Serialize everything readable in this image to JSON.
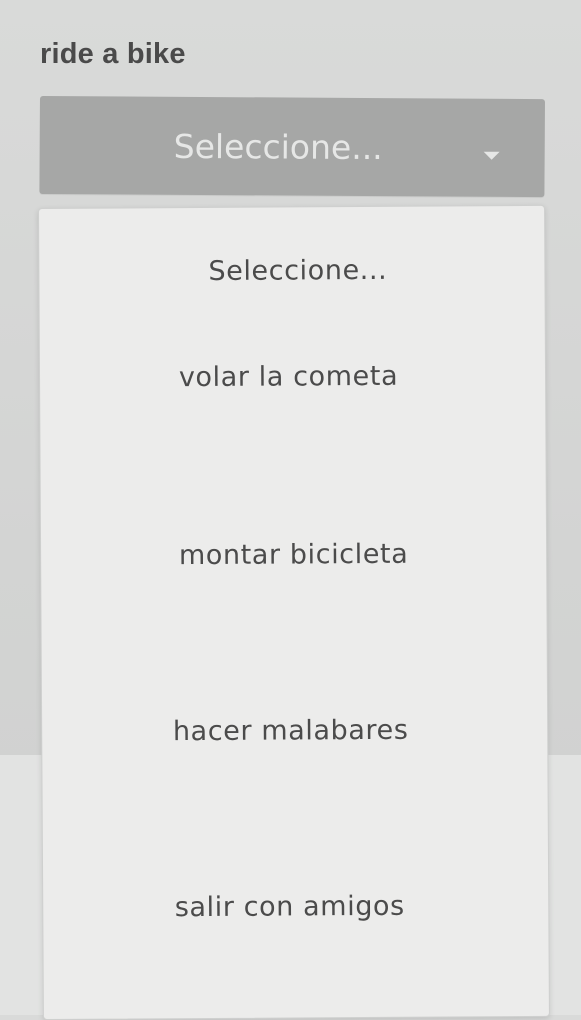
{
  "question": {
    "label": "ride a bike"
  },
  "select": {
    "value": "Seleccione...",
    "caret_icon": "chevron-down-icon"
  },
  "dropdown": {
    "options": [
      "Seleccione...",
      "volar la cometa",
      "montar bicicleta",
      "hacer malabares",
      "salir con amigos"
    ]
  },
  "colors": {
    "select_background": "#a6a7a6",
    "select_text": "#e6e7e6",
    "menu_background": "#ececeb",
    "option_text": "#4b4b4b",
    "label_text": "#4a4a4a"
  }
}
